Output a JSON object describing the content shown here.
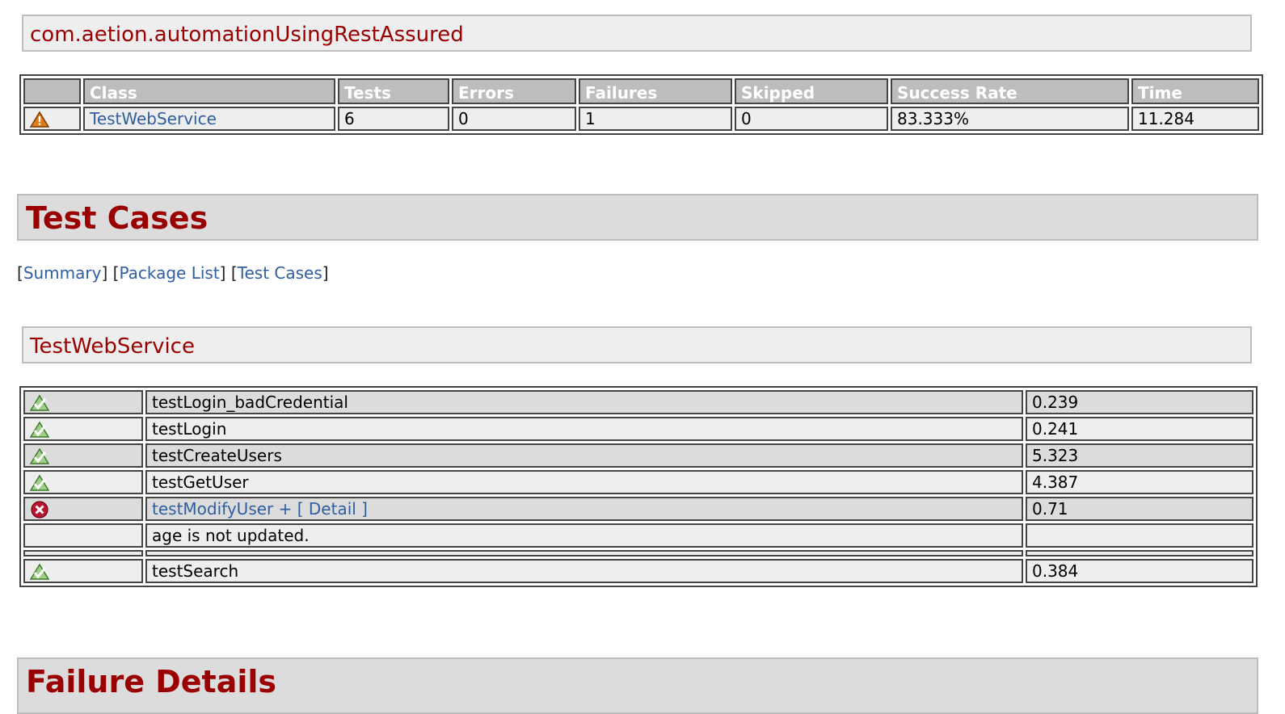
{
  "package": {
    "title": "com.aetion.automationUsingRestAssured"
  },
  "summary_table": {
    "headers": [
      "",
      "Class",
      "Tests",
      "Errors",
      "Failures",
      "Skipped",
      "Success Rate",
      "Time"
    ],
    "rows": [
      {
        "status_icon": "warning-icon",
        "class": "TestWebService",
        "tests": "6",
        "errors": "0",
        "failures": "1",
        "skipped": "0",
        "success_rate": "83.333%",
        "time": "11.284"
      }
    ]
  },
  "test_cases_heading": "Test Cases",
  "nav": {
    "open1": "[",
    "summary": "Summary",
    "close1": "]",
    "open2": " [",
    "package_list": "Package List",
    "close2": "]",
    "open3": " [",
    "test_cases": "Test Cases",
    "close3": "]"
  },
  "class_title": "TestWebService",
  "cases": [
    {
      "status_icon": "pass-icon",
      "name": "testLogin_badCredential",
      "time": "0.239"
    },
    {
      "status_icon": "pass-icon",
      "name": "testLogin",
      "time": "0.241"
    },
    {
      "status_icon": "pass-icon",
      "name": "testCreateUsers",
      "time": "5.323"
    },
    {
      "status_icon": "pass-icon",
      "name": "testGetUser",
      "time": "4.387"
    },
    {
      "status_icon": "fail-icon",
      "name": "testModifyUser",
      "detail_link": " + [ Detail ]",
      "time": "0.71"
    },
    {
      "status_icon": "",
      "name": "age is not updated.",
      "time": ""
    },
    {
      "status_icon": "pass-icon",
      "name": "testSearch",
      "time": "0.384"
    }
  ],
  "failure_heading": "Failure Details",
  "colors": {
    "heading_red": "#9a0000",
    "link_blue": "#2f5e9e",
    "header_gray": "#bdbdbd",
    "row_dark": "#dcdcdc",
    "row_light": "#eeeeee"
  }
}
